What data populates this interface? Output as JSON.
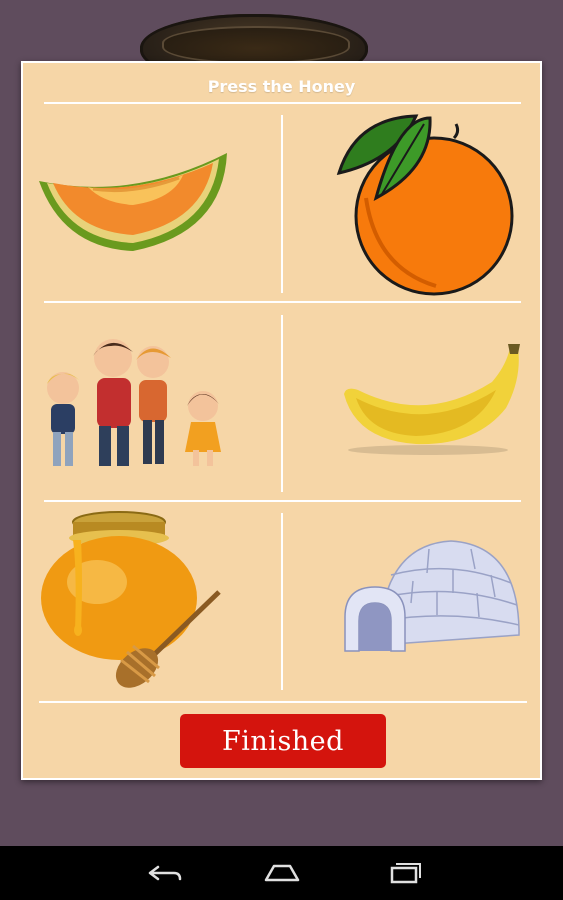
{
  "screen": {
    "title": "Press the Honey",
    "finish_label": "Finished"
  },
  "choices": [
    {
      "name": "cantaloupe",
      "icon": "cantaloupe-slice-icon"
    },
    {
      "name": "orange",
      "icon": "orange-icon"
    },
    {
      "name": "family",
      "icon": "family-icon"
    },
    {
      "name": "banana",
      "icon": "banana-icon"
    },
    {
      "name": "honey",
      "icon": "honey-pot-icon"
    },
    {
      "name": "igloo",
      "icon": "igloo-icon"
    }
  ],
  "navigation": {
    "buttons": [
      "back-icon",
      "home-icon",
      "recent-apps-icon"
    ]
  },
  "colors": {
    "background": "#5f4c5d",
    "card": "#f6d6a7",
    "finish_button": "#d4140d"
  }
}
